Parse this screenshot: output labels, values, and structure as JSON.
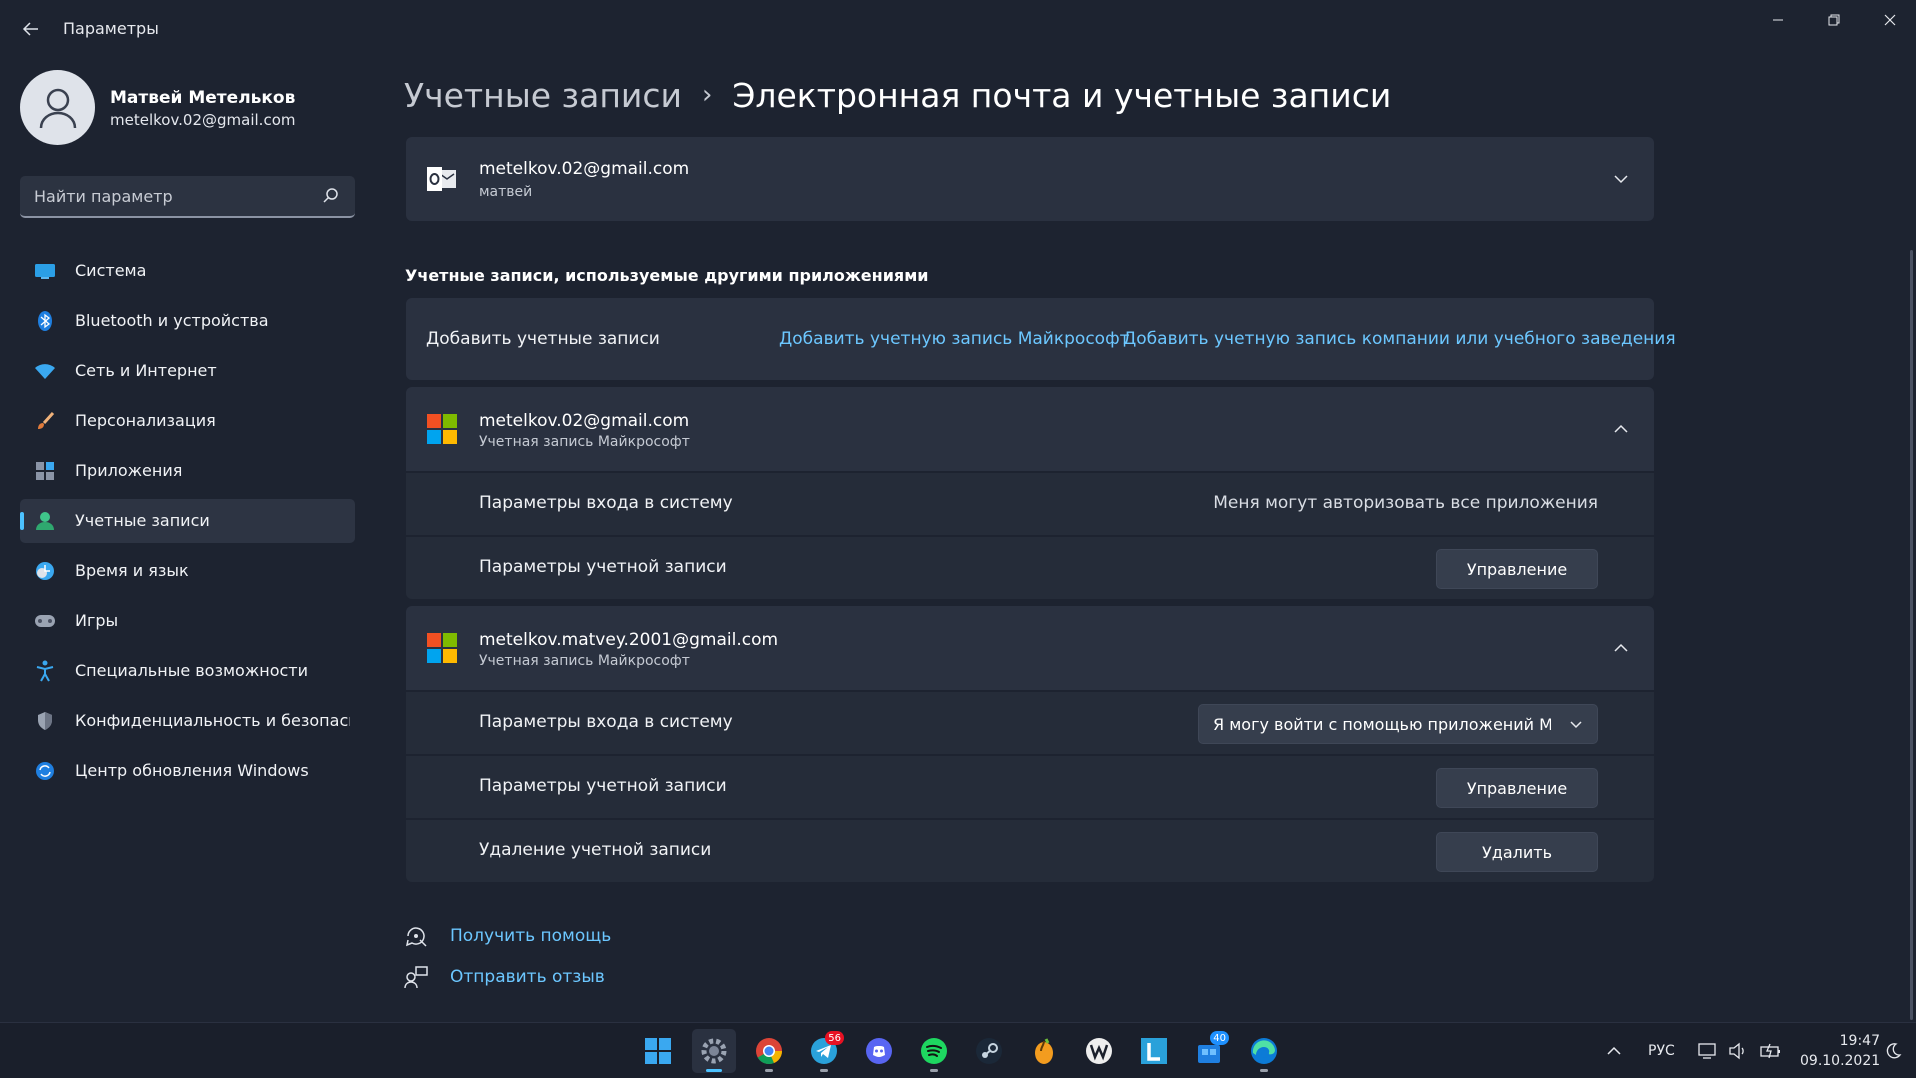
{
  "window": {
    "back_icon": "back-arrow-icon",
    "title": "Параметры"
  },
  "profile": {
    "name": "Матвей Метельков",
    "email": "metelkov.02@gmail.com"
  },
  "search": {
    "placeholder": "Найти параметр"
  },
  "sidebar": {
    "items": [
      {
        "label": "Система",
        "icon": "system-icon"
      },
      {
        "label": "Bluetooth и устройства",
        "icon": "bluetooth-icon"
      },
      {
        "label": "Сеть и Интернет",
        "icon": "wifi-icon"
      },
      {
        "label": "Персонализация",
        "icon": "brush-icon"
      },
      {
        "label": "Приложения",
        "icon": "apps-icon"
      },
      {
        "label": "Учетные записи",
        "icon": "accounts-icon",
        "active": true
      },
      {
        "label": "Время и язык",
        "icon": "time-language-icon"
      },
      {
        "label": "Игры",
        "icon": "gamepad-icon"
      },
      {
        "label": "Специальные возможности",
        "icon": "accessibility-icon"
      },
      {
        "label": "Конфиденциальность и безопасность",
        "icon": "shield-icon"
      },
      {
        "label": "Центр обновления Windows",
        "icon": "update-icon"
      }
    ]
  },
  "header": {
    "parent": "Учетные записи",
    "separator": "›",
    "current": "Электронная почта и учетные записи"
  },
  "outlook_account": {
    "email": "metelkov.02@gmail.com",
    "name": "матвей"
  },
  "other_apps": {
    "section_title": "Учетные записи, используемые другими приложениями",
    "add_label": "Добавить учетные записи",
    "add_ms_link": "Добавить учетную запись Майкрософт",
    "add_work_link": "Добавить учетную запись компании или учебного заведения"
  },
  "accounts": [
    {
      "email": "metelkov.02@gmail.com",
      "type": "Учетная запись Майкрософт",
      "signin_label": "Параметры входа в систему",
      "signin_value": "Меня могут авторизовать все приложения",
      "settings_label": "Параметры учетной записи",
      "manage_button": "Управление"
    },
    {
      "email": "metelkov.matvey.2001@gmail.com",
      "type": "Учетная запись Майкрософт",
      "signin_label": "Параметры входа в систему",
      "signin_dropdown": "Я могу войти с помощью приложений Майкрософт",
      "settings_label": "Параметры учетной записи",
      "manage_button": "Управление",
      "remove_label": "Удаление учетной записи",
      "remove_button": "Удалить"
    }
  ],
  "footer": {
    "help": "Получить помощь",
    "feedback": "Отправить отзыв"
  },
  "taskbar": {
    "apps": [
      {
        "name": "start-icon"
      },
      {
        "name": "settings-icon",
        "active": true
      },
      {
        "name": "chrome-icon"
      },
      {
        "name": "telegram-icon",
        "badge": "56"
      },
      {
        "name": "discord-icon"
      },
      {
        "name": "spotify-icon"
      },
      {
        "name": "steam-icon"
      },
      {
        "name": "fl-studio-icon"
      },
      {
        "name": "wolfram-icon"
      },
      {
        "name": "l-app-icon"
      },
      {
        "name": "store-icon",
        "badge": "40"
      },
      {
        "name": "edge-icon"
      }
    ],
    "language": "РУС",
    "time": "19:47",
    "date": "09.10.2021"
  },
  "colors": {
    "background": "#1d2330",
    "card": "#2a3140",
    "accent": "#4cc2ff",
    "link": "#6cc7ff"
  }
}
